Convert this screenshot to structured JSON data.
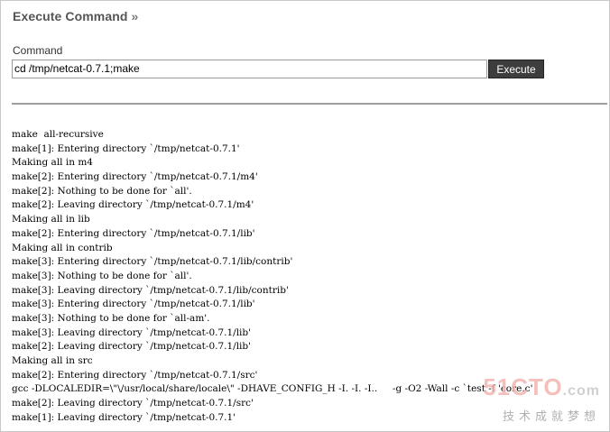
{
  "header": {
    "title": "Execute Command",
    "title_suffix": "»"
  },
  "command": {
    "label": "Command",
    "value": "cd /tmp/netcat-0.7.1;make",
    "button_label": "Execute"
  },
  "output": {
    "lines": [
      "make  all-recursive",
      "make[1]: Entering directory `/tmp/netcat-0.7.1'",
      "Making all in m4",
      "make[2]: Entering directory `/tmp/netcat-0.7.1/m4'",
      "make[2]: Nothing to be done for `all'.",
      "make[2]: Leaving directory `/tmp/netcat-0.7.1/m4'",
      "Making all in lib",
      "make[2]: Entering directory `/tmp/netcat-0.7.1/lib'",
      "Making all in contrib",
      "make[3]: Entering directory `/tmp/netcat-0.7.1/lib/contrib'",
      "make[3]: Nothing to be done for `all'.",
      "make[3]: Leaving directory `/tmp/netcat-0.7.1/lib/contrib'",
      "make[3]: Entering directory `/tmp/netcat-0.7.1/lib'",
      "make[3]: Nothing to be done for `all-am'.",
      "make[3]: Leaving directory `/tmp/netcat-0.7.1/lib'",
      "make[2]: Leaving directory `/tmp/netcat-0.7.1/lib'",
      "Making all in src",
      "make[2]: Entering directory `/tmp/netcat-0.7.1/src'",
      "gcc -DLOCALEDIR=\\\"\\/usr/local/share/locale\\\" -DHAVE_CONFIG_H -I. -I. -I..     -g -O2 -Wall -c `test -f 'core.c'",
      "make[2]: Leaving directory `/tmp/netcat-0.7.1/src'",
      "make[1]: Leaving directory `/tmp/netcat-0.7.1'"
    ]
  },
  "watermark": {
    "logo": "51CTO",
    "logo_suffix": ".com",
    "subtitle": "技术成就梦想"
  }
}
